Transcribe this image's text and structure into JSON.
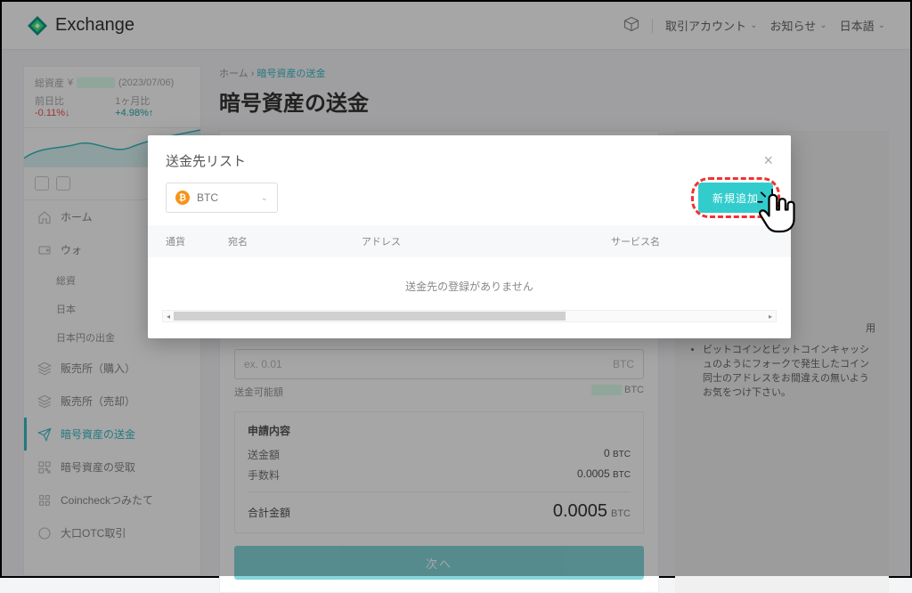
{
  "header": {
    "brand": "Exchange",
    "account": "取引アカウント",
    "notice": "お知らせ",
    "lang": "日本語"
  },
  "sidebar_top": {
    "label_asset": "総資産",
    "currency_mark": "¥",
    "date": "(2023/07/06)",
    "day_label": "前日比",
    "day_pct": "-0.11%↓",
    "month_label": "1ヶ月比",
    "month_pct": "+4.98%↑"
  },
  "sidebar": {
    "items": [
      {
        "label": "ホーム"
      },
      {
        "label": "ウォ"
      },
      {
        "sub1": "総資"
      },
      {
        "sub2": "日本"
      },
      {
        "sub3": "日本円の出金"
      },
      {
        "label": "販売所（購入）"
      },
      {
        "label": "販売所（売却）"
      },
      {
        "label": "暗号資産の送金"
      },
      {
        "label": "暗号資産の受取"
      },
      {
        "label": "Coincheckつみたて"
      },
      {
        "label": "大口OTC取引"
      }
    ]
  },
  "crumbs": {
    "home": "ホーム",
    "sep": "›",
    "page": "暗号資産の送金"
  },
  "page_title": "暗号資産の送金",
  "form": {
    "amount_ph": "ex. 0.01",
    "amount_unit": "BTC",
    "avail_label": "送金可能額",
    "avail_unit": "BTC"
  },
  "apply": {
    "title": "申請内容",
    "row1_label": "送金額",
    "row1_val": "0",
    "row1_unit": "BTC",
    "row2_label": "手数料",
    "row2_val": "0.0005",
    "row2_unit": "BTC",
    "total_label": "合計金額",
    "total_val": "0.0005",
    "total_unit": "BTC"
  },
  "next_button": "次へ",
  "note": {
    "line1": "用",
    "line2": "ビットコインとビットコインキャッシュのようにフォークで発生したコイン同士のアドレスをお間違えの無いようお気をつけ下さい。"
  },
  "modal": {
    "title": "送金先リスト",
    "currency": "BTC",
    "add_button": "新規追加",
    "th_currency": "通貨",
    "th_name": "宛名",
    "th_address": "アドレス",
    "th_service": "サービス名",
    "empty": "送金先の登録がありません"
  }
}
